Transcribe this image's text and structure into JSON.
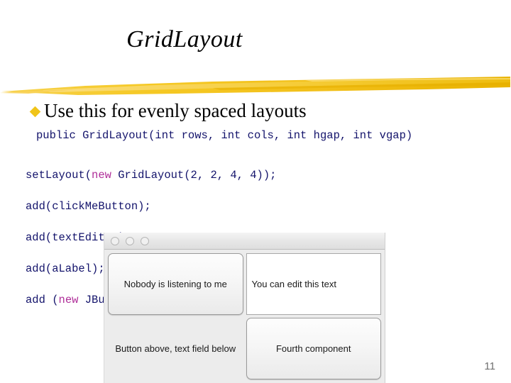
{
  "slide": {
    "title": "GridLayout",
    "page_number": "11",
    "accent_color": "#F0C419",
    "code_color": "#13136b",
    "keyword_color": "#b0309a"
  },
  "bullet": {
    "icon": "diamond-bullet-icon",
    "text": "Use this for evenly spaced layouts"
  },
  "code": {
    "signature": "public GridLayout(int rows, int cols, int hgap, int vgap)",
    "line1_pre": "setLayout(",
    "line1_kw": "new",
    "line1_post": " GridLayout(2, 2, 4, 4));",
    "line2": "add(clickMeButton);",
    "line3": "add(textEditor);",
    "line4": "add(aLabel);",
    "line5_pre": "add (",
    "line5_kw": "new",
    "line5_post": " JButton(\"Fourth component\"));"
  },
  "swing_window": {
    "titlebar": {
      "close_label": "",
      "minimize_label": "",
      "zoom_label": ""
    },
    "cells": [
      {
        "kind": "button",
        "text": "Nobody is listening to me"
      },
      {
        "kind": "textfield",
        "text": "You can edit this text"
      },
      {
        "kind": "label",
        "text": "Button above, text field below"
      },
      {
        "kind": "button",
        "text": "Fourth component"
      }
    ]
  }
}
